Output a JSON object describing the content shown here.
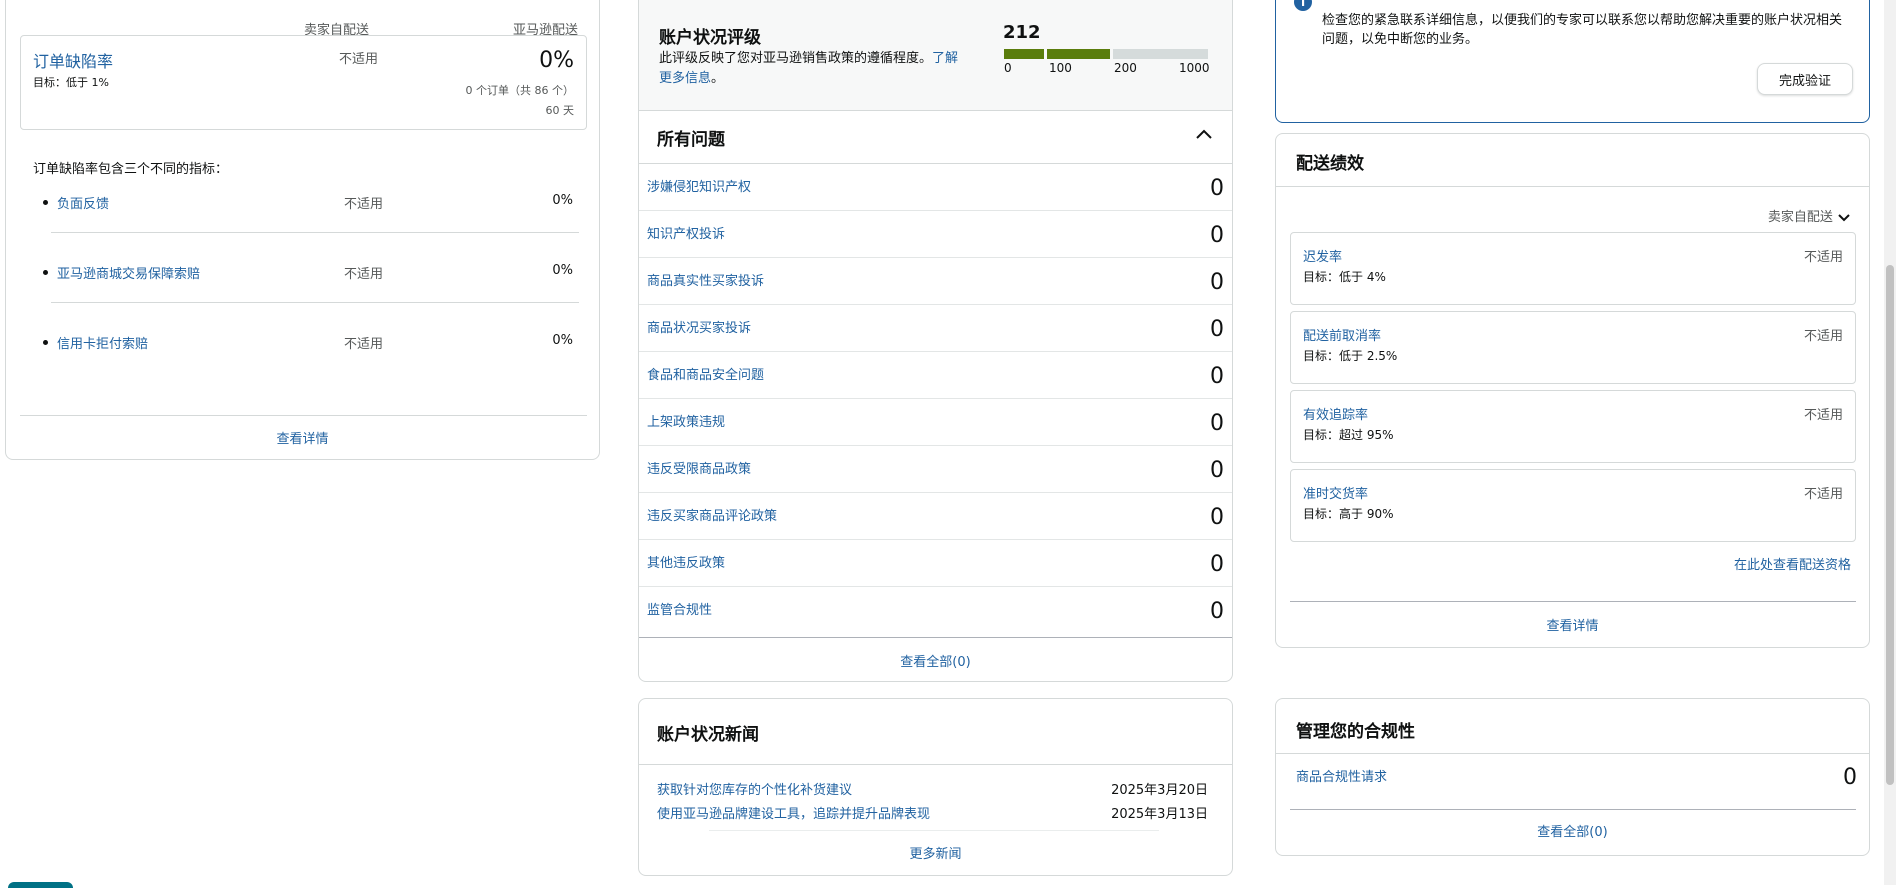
{
  "left_card": {
    "col_headers": [
      "卖家自配送",
      "亚马逊配送"
    ],
    "odr": {
      "title": "订单缺陷率",
      "target": "目标：低于 1%",
      "mfn_value": "不适用",
      "afn_value": "0%",
      "orders": "0 个订单（共 86 个）",
      "period": "60 天"
    },
    "intro": "订单缺陷率包含三个不同的指标：",
    "metrics": [
      {
        "name": "负面反馈",
        "mfn": "不适用",
        "afn": "0%"
      },
      {
        "name": "亚马逊商城交易保障索赔",
        "mfn": "不适用",
        "afn": "0%"
      },
      {
        "name": "信用卡拒付索赔",
        "mfn": "不适用",
        "afn": "0%"
      }
    ],
    "view_details": "查看详情"
  },
  "rating": {
    "title": "账户状况评级",
    "desc": "此评级反映了您对亚马逊销售政策的遵循程度。",
    "learn_more": "了解更多信息",
    "desc_end": "。",
    "score": "212",
    "ticks": [
      "0",
      "100",
      "200",
      "1000"
    ],
    "colors": {
      "good": "#5a7d0c",
      "track": "#d5dbdb"
    }
  },
  "issues": {
    "title": "所有问题",
    "rows": [
      {
        "name": "涉嫌侵犯知识产权",
        "count": "0"
      },
      {
        "name": "知识产权投诉",
        "count": "0"
      },
      {
        "name": "商品真实性买家投诉",
        "count": "0"
      },
      {
        "name": "商品状况买家投诉",
        "count": "0"
      },
      {
        "name": "食品和商品安全问题",
        "count": "0"
      },
      {
        "name": "上架政策违规",
        "count": "0"
      },
      {
        "name": "违反受限商品政策",
        "count": "0"
      },
      {
        "name": "违反买家商品评论政策",
        "count": "0"
      },
      {
        "name": "其他违反政策",
        "count": "0"
      },
      {
        "name": "监管合规性",
        "count": "0"
      }
    ],
    "view_all": "查看全部(0)"
  },
  "news": {
    "title": "账户状况新闻",
    "items": [
      {
        "title": "获取针对您库存的个性化补货建议",
        "date": "2025年3月20日"
      },
      {
        "title": "使用亚马逊品牌建设工具，追踪并提升品牌表现",
        "date": "2025年3月13日"
      }
    ],
    "more": "更多新闻"
  },
  "verify": {
    "text": "检查您的紧急联系详细信息，以便我们的专家可以联系您以帮助您解决重要的账户状况相关问题，以免中断您的业务。",
    "button": "完成验证",
    "accent": "#2162a1"
  },
  "shipping": {
    "title": "配送绩效",
    "filter": "卖家自配送",
    "items": [
      {
        "name": "迟发率",
        "target": "目标：低于 4%",
        "value": "不适用"
      },
      {
        "name": "配送前取消率",
        "target": "目标：低于 2.5%",
        "value": "不适用"
      },
      {
        "name": "有效追踪率",
        "target": "目标：超过 95%",
        "value": "不适用"
      },
      {
        "name": "准时交货率",
        "target": "目标：高于 90%",
        "value": "不适用"
      }
    ],
    "eligibility_link": "在此处查看配送资格",
    "view_details": "查看详情"
  },
  "compliance": {
    "title": "管理您的合规性",
    "item": "商品合规性请求",
    "count": "0",
    "view_all": "查看全部(0)"
  }
}
